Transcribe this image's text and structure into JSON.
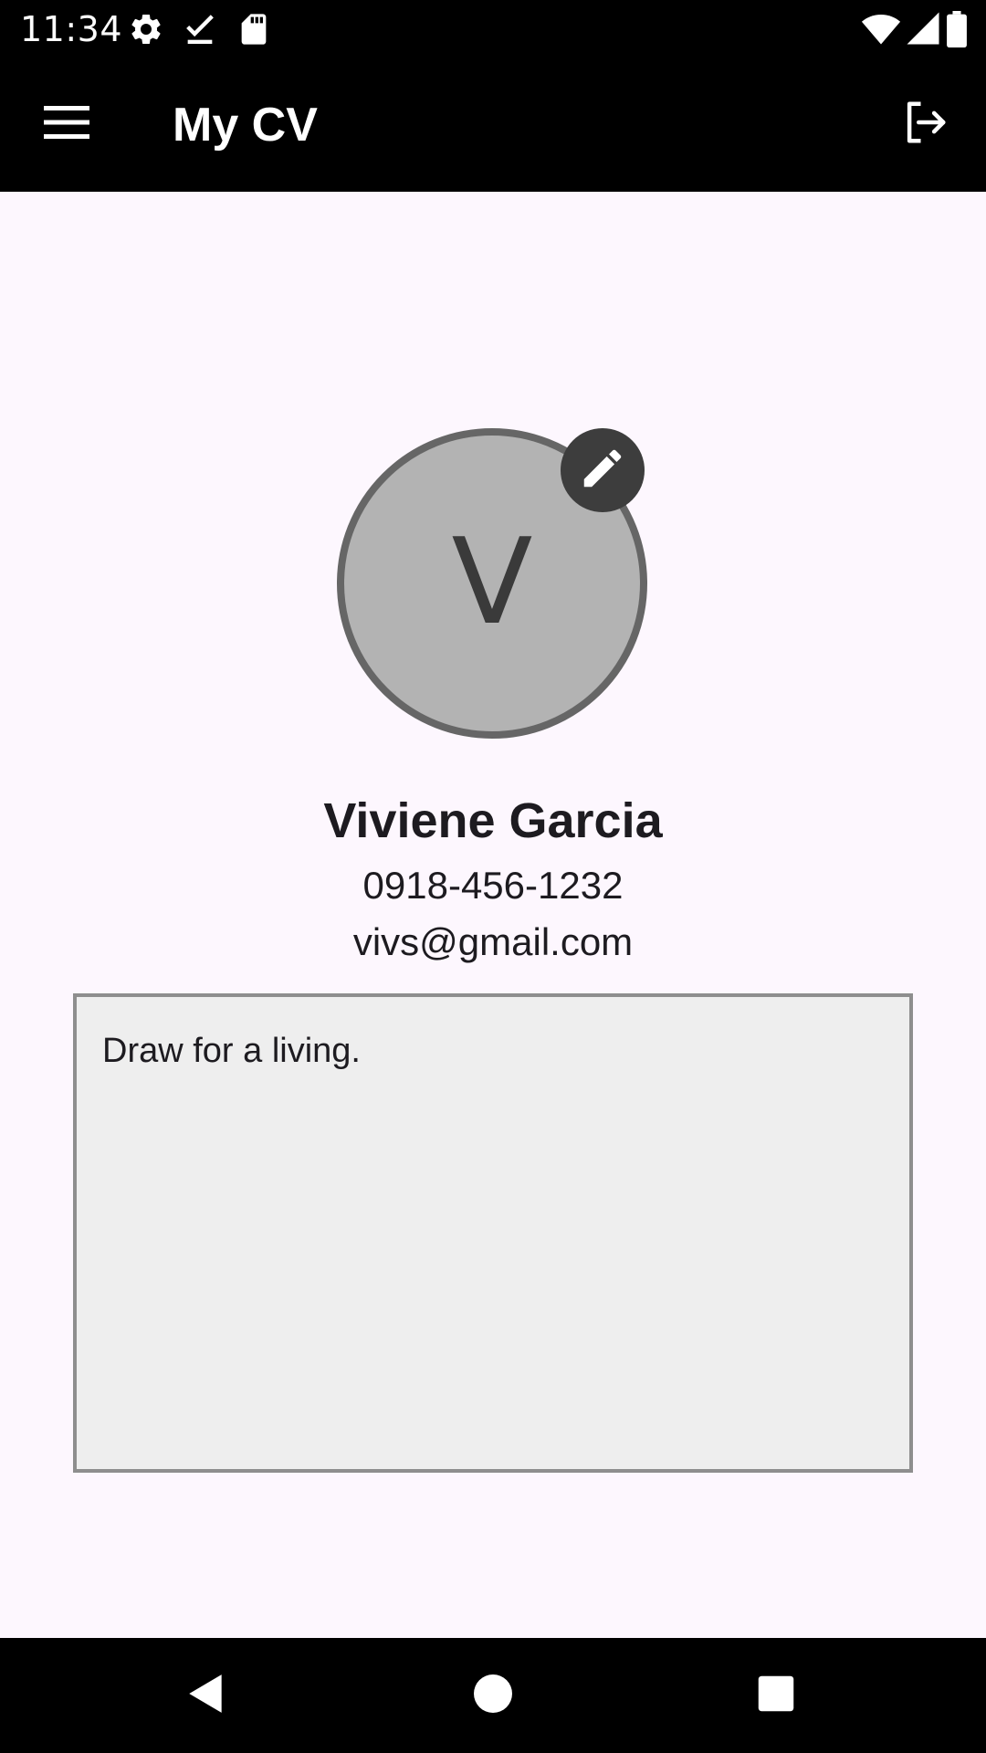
{
  "status_bar": {
    "time": "11:34",
    "icons": [
      "gear-icon",
      "check-icon",
      "sd-card-icon",
      "wifi-icon",
      "signal-icon",
      "battery-icon"
    ]
  },
  "app_bar": {
    "title": "My CV",
    "left_icon": "menu-icon",
    "right_icon": "logout-icon"
  },
  "profile": {
    "avatar_initial": "V",
    "edit_icon": "pencil-icon",
    "name": "Viviene Garcia",
    "phone": "0918-456-1232",
    "email": "vivs@gmail.com",
    "bio": "Draw for a living."
  },
  "nav_bar": {
    "icons": [
      "back-icon",
      "home-icon",
      "recents-icon"
    ]
  },
  "colors": {
    "background": "#fdf7fe",
    "bars": "#000000",
    "avatar_fill": "#b3b3b3",
    "avatar_border": "#666666",
    "edit_button": "#3d3d3d",
    "bio_fill": "#eeeeee",
    "bio_border": "#8e8e8e"
  }
}
